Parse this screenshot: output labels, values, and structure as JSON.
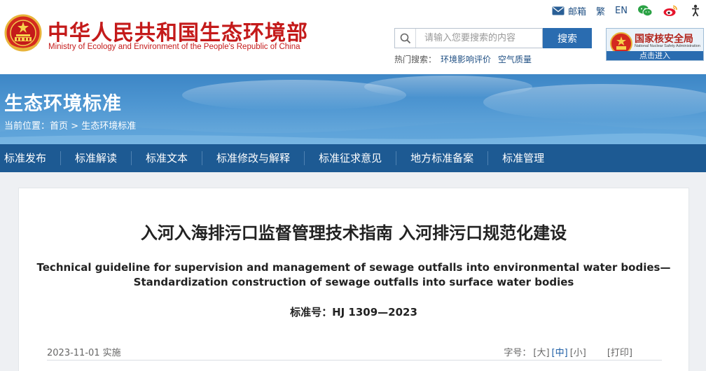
{
  "header": {
    "site_name_cn": "中华人民共和国生态环境部",
    "site_name_en": "Ministry of Ecology and Environment of the People's Republic of China",
    "top_links": {
      "mail": "邮箱",
      "traditional": "繁",
      "english": "EN"
    },
    "search": {
      "placeholder": "请输入您要搜索的内容",
      "button": "搜索"
    },
    "hot_search": {
      "label": "热门搜索：",
      "items": [
        "环境影响评价",
        "空气质量"
      ]
    },
    "nnsa": {
      "name": "国家核安全局",
      "name_en": "National Nuclear Safety Administration",
      "enter": "点击进入"
    }
  },
  "banner": {
    "title": "生态环境标准",
    "breadcrumb": {
      "label": "当前位置：",
      "home": "首页",
      "separator": ">",
      "current": "生态环境标准"
    }
  },
  "nav": {
    "items": [
      {
        "label": "标准发布"
      },
      {
        "label": "标准解读"
      },
      {
        "label": "标准文本"
      },
      {
        "label": "标准修改与解释"
      },
      {
        "label": "标准征求意见"
      },
      {
        "label": "地方标准备案"
      },
      {
        "label": "标准管理"
      }
    ]
  },
  "article": {
    "title_cn": "入河入海排污口监督管理技术指南 入河排污口规范化建设",
    "title_en_line1": "Technical guideline for supervision and management of sewage outfalls into environmental water bodies—",
    "title_en_line2": "Standardization construction of sewage outfalls into surface water bodies",
    "standard_no": "标准号：HJ 1309—2023",
    "date": "2023-11-01 实施",
    "font_label": "字号：",
    "font_large": "[大]",
    "font_medium": "[中]",
    "font_small": "[小]",
    "print": "[打印]"
  },
  "colors": {
    "brand_red": "#c41a1a",
    "nav_blue": "#1d5a93",
    "accent_blue": "#2a6cb0"
  },
  "icons": {
    "emblem": "national-emblem-icon",
    "mail": "mail-icon",
    "wechat": "wechat-icon",
    "weibo": "weibo-icon",
    "accessibility": "people-icon",
    "search": "search-icon"
  }
}
